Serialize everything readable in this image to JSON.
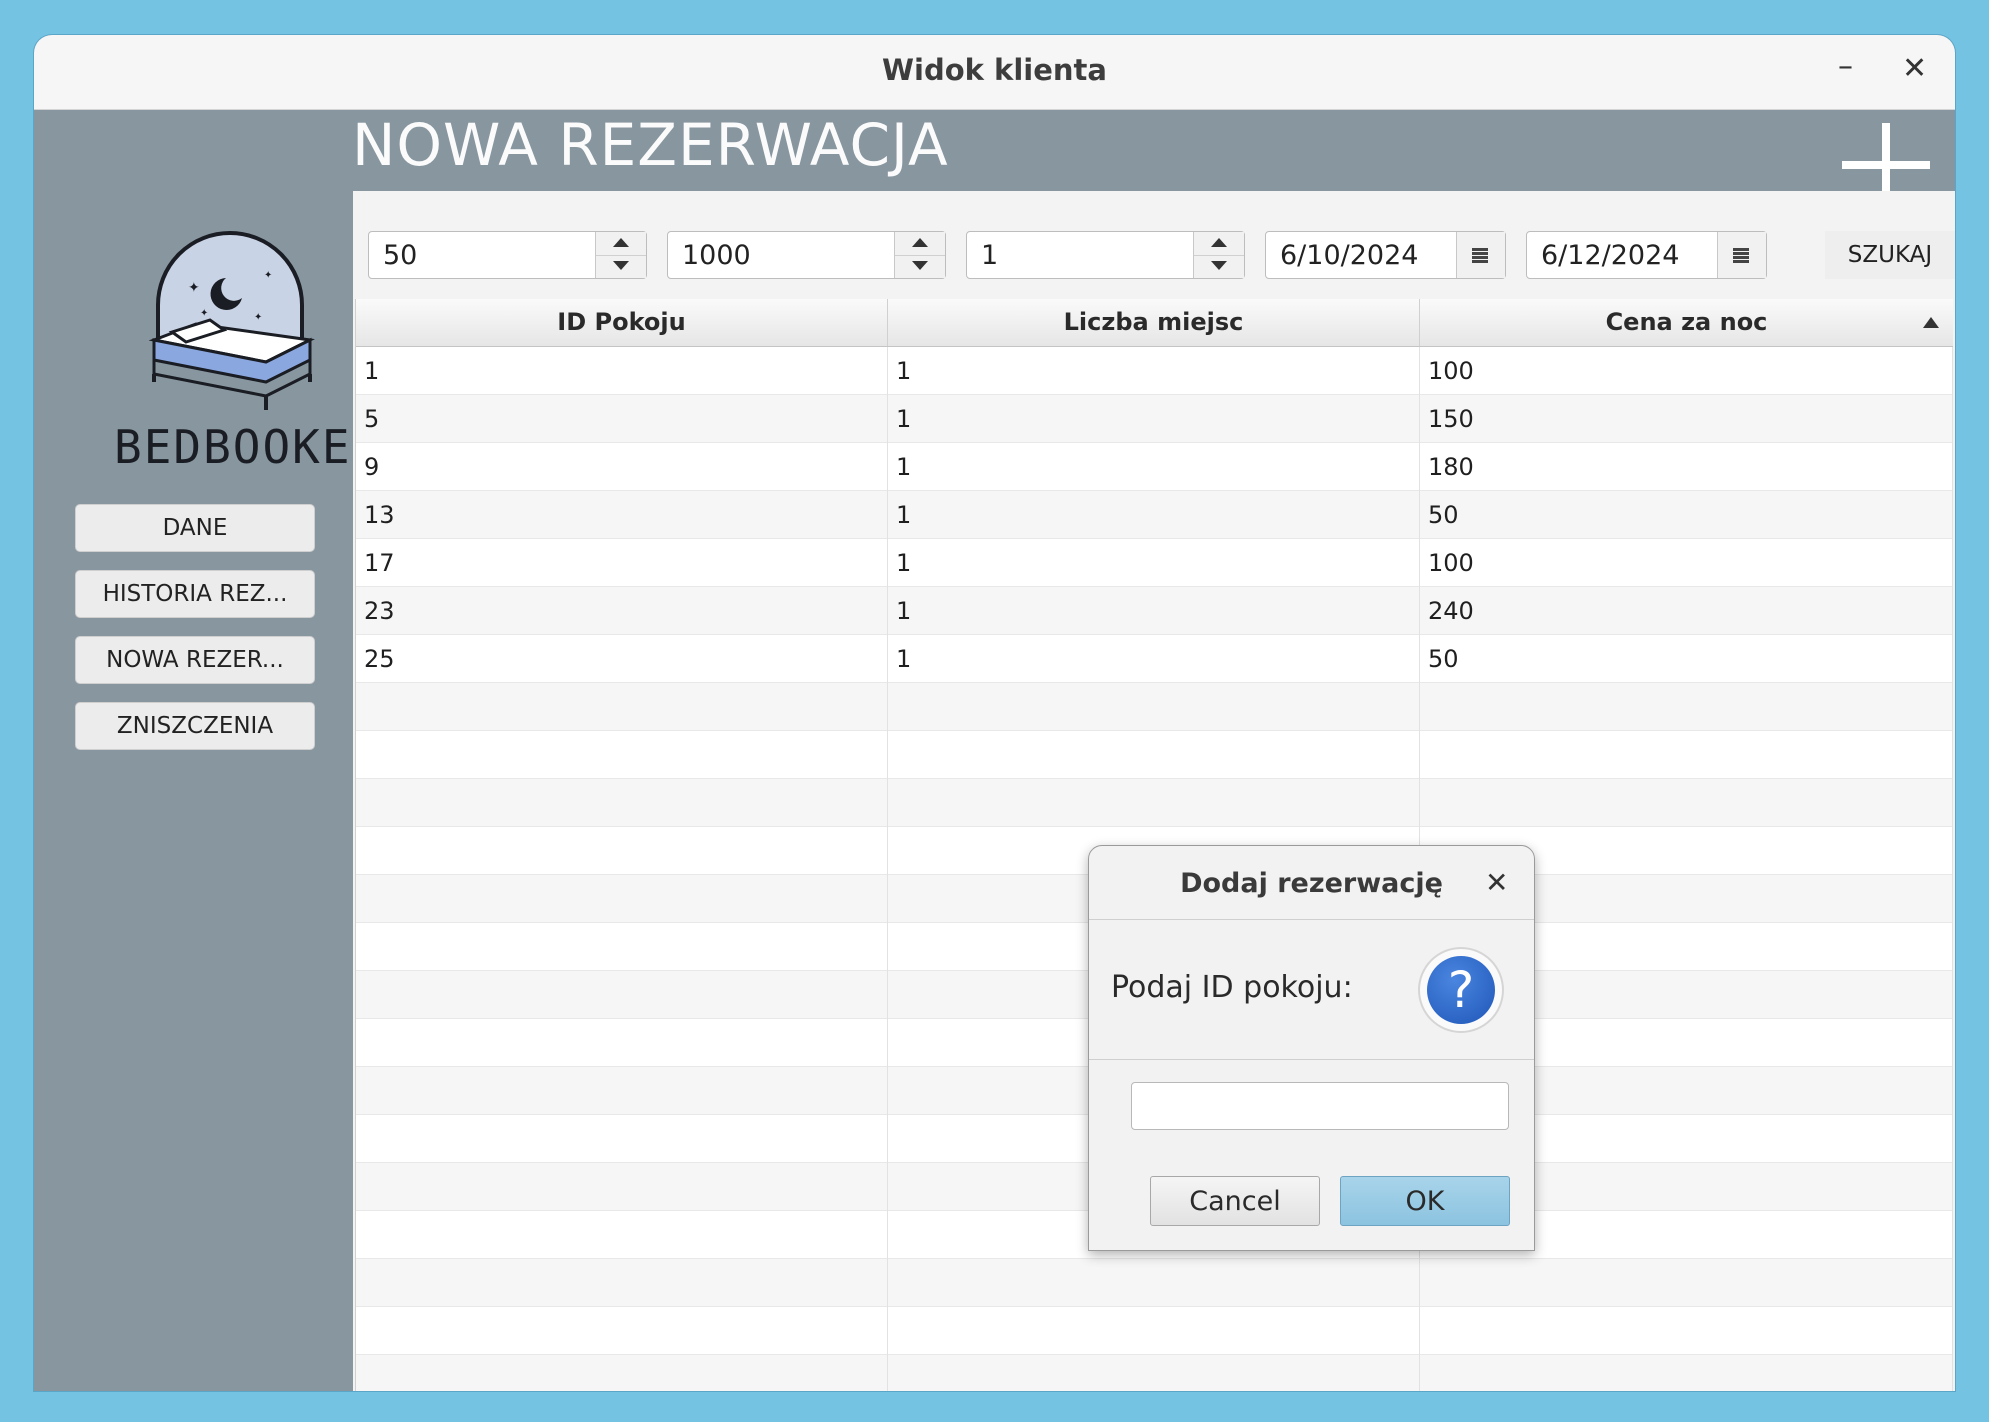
{
  "window": {
    "title": "Widok klienta",
    "minimize_glyph": "–",
    "close_glyph": "✕"
  },
  "header": {
    "title": "NOWA REZERWACJA",
    "add_icon": "plus-icon"
  },
  "logo": {
    "text": "BEDBOOKER",
    "icon": "bed-moon-icon"
  },
  "sidebar": {
    "items": [
      {
        "label": "DANE"
      },
      {
        "label": "HISTORIA REZ..."
      },
      {
        "label": "NOWA REZER..."
      },
      {
        "label": "ZNISZCZENIA"
      }
    ]
  },
  "filters": {
    "price_min": "50",
    "price_max": "1000",
    "places": "1",
    "date_from": "6/10/2024",
    "date_to": "6/12/2024",
    "search_label": "SZUKAJ"
  },
  "table": {
    "columns": [
      "ID Pokoju",
      "Liczba miejsc",
      "Cena za noc"
    ],
    "sort_column": "Cena za noc",
    "rows": [
      [
        "1",
        "1",
        "100"
      ],
      [
        "5",
        "1",
        "150"
      ],
      [
        "9",
        "1",
        "180"
      ],
      [
        "13",
        "1",
        "50"
      ],
      [
        "17",
        "1",
        "100"
      ],
      [
        "23",
        "1",
        "240"
      ],
      [
        "25",
        "1",
        "50"
      ]
    ]
  },
  "dialog": {
    "title": "Dodaj rezerwację",
    "close_glyph": "✕",
    "message": "Podaj ID pokoju:",
    "icon_glyph": "?",
    "input_value": "",
    "cancel_label": "Cancel",
    "ok_label": "OK"
  },
  "colors": {
    "desktop": "#74c3e3",
    "sidebar": "#8896a0",
    "ok_button": "#8cc3e0",
    "help_icon": "#1f56b8"
  }
}
